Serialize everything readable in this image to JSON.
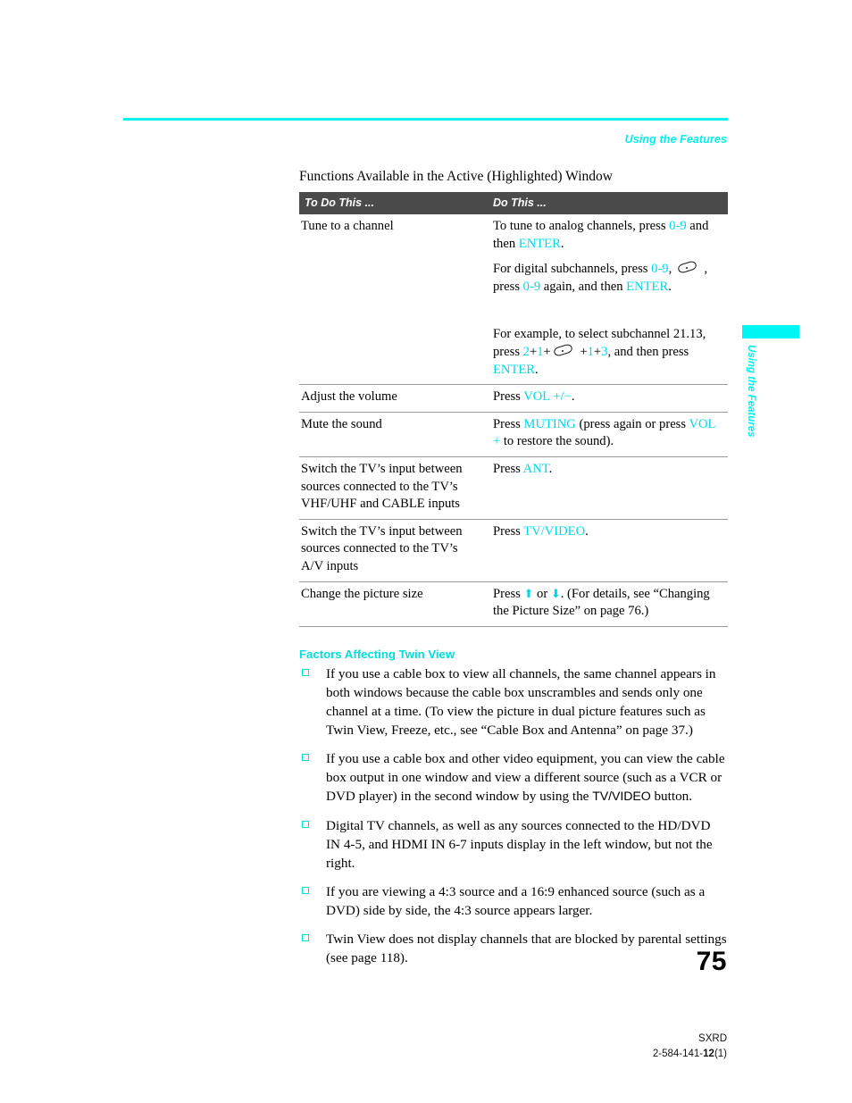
{
  "header": {
    "running_head": "Using the Features",
    "rule_color": "#00f0f0"
  },
  "side_tab": {
    "label": "Using the Features",
    "bar_color": "#00f5f5"
  },
  "table_caption": "Functions Available in the Active (Highlighted) Window",
  "table": {
    "columns": [
      "To Do This ...",
      "Do This ..."
    ],
    "header_bg": "#4b4b4b",
    "header_color": "#ffffff",
    "rows": [
      {
        "todo": "Tune to a channel",
        "do_paragraphs": [
          {
            "parts": [
              {
                "t": "To tune to analog channels, press ",
                "s": "plain"
              },
              {
                "t": "0-9",
                "s": "key"
              },
              {
                "t": " and then ",
                "s": "plain"
              },
              {
                "t": "ENTER",
                "s": "key"
              },
              {
                "t": ".",
                "s": "plain"
              }
            ]
          },
          {
            "parts": [
              {
                "t": "For digital subchannels, press ",
                "s": "plain"
              },
              {
                "t": "0-9",
                "s": "key"
              },
              {
                "t": ", ",
                "s": "plain"
              },
              {
                "t": "",
                "s": "dot-button"
              },
              {
                "t": " , press ",
                "s": "plain"
              },
              {
                "t": "0-9",
                "s": "key"
              },
              {
                "t": " again, and then ",
                "s": "plain"
              },
              {
                "t": "ENTER",
                "s": "key"
              },
              {
                "t": ".",
                "s": "plain"
              }
            ]
          },
          {
            "gap": "big",
            "parts": [
              {
                "t": "For example, to select subchannel 21.13, press ",
                "s": "plain"
              },
              {
                "t": "2",
                "s": "key"
              },
              {
                "t": "+",
                "s": "plain"
              },
              {
                "t": "1",
                "s": "key"
              },
              {
                "t": "+",
                "s": "plain"
              },
              {
                "t": "",
                "s": "dot-button"
              },
              {
                "t": " +",
                "s": "plain"
              },
              {
                "t": "1",
                "s": "key"
              },
              {
                "t": "+",
                "s": "plain"
              },
              {
                "t": "3",
                "s": "key"
              },
              {
                "t": ", and then press ",
                "s": "plain"
              },
              {
                "t": "ENTER",
                "s": "key"
              },
              {
                "t": ".",
                "s": "plain"
              }
            ]
          }
        ]
      },
      {
        "todo": "Adjust the volume",
        "do_paragraphs": [
          {
            "parts": [
              {
                "t": "Press ",
                "s": "plain"
              },
              {
                "t": "VOL +/−",
                "s": "key"
              },
              {
                "t": ".",
                "s": "plain"
              }
            ]
          }
        ]
      },
      {
        "todo": "Mute the sound",
        "do_paragraphs": [
          {
            "parts": [
              {
                "t": "Press ",
                "s": "plain"
              },
              {
                "t": "MUTING",
                "s": "key"
              },
              {
                "t": " (press again or press ",
                "s": "plain"
              },
              {
                "t": "VOL +",
                "s": "key"
              },
              {
                "t": " to restore the sound).",
                "s": "plain"
              }
            ]
          }
        ]
      },
      {
        "todo": "Switch the TV’s input between sources connected to the TV’s VHF/UHF and CABLE inputs",
        "do_paragraphs": [
          {
            "parts": [
              {
                "t": "Press ",
                "s": "plain"
              },
              {
                "t": "ANT",
                "s": "key"
              },
              {
                "t": ".",
                "s": "plain"
              }
            ]
          }
        ]
      },
      {
        "todo": "Switch the TV’s input between sources connected to the TV’s A/V inputs",
        "do_paragraphs": [
          {
            "parts": [
              {
                "t": "Press ",
                "s": "plain"
              },
              {
                "t": "TV/VIDEO",
                "s": "key"
              },
              {
                "t": ".",
                "s": "plain"
              }
            ]
          }
        ]
      },
      {
        "todo": "Change the picture size",
        "do_paragraphs": [
          {
            "parts": [
              {
                "t": "Press ",
                "s": "plain"
              },
              {
                "t": "⬆",
                "s": "arrow-up"
              },
              {
                "t": " or ",
                "s": "plain"
              },
              {
                "t": "⬇",
                "s": "arrow-down"
              },
              {
                "t": ". (For details, see “Changing the Picture Size” on page 76.)",
                "s": "plain"
              }
            ]
          }
        ]
      }
    ]
  },
  "section": {
    "heading": "Factors Affecting Twin View",
    "bullets": [
      {
        "parts": [
          {
            "t": "If you use a cable box to view all channels, the same channel appears in both windows because the cable box unscrambles and sends only one channel at a time. (To view the picture in dual picture features such as Twin View, Freeze, etc., see “Cable Box and Antenna” on page 37.)",
            "s": "plain"
          }
        ]
      },
      {
        "parts": [
          {
            "t": "If you use a cable box and other video equipment, you can view the cable box output in one window and view a different source (such as a VCR or DVD player) in the second window by using the ",
            "s": "plain"
          },
          {
            "t": "TV/VIDEO",
            "s": "keyblack"
          },
          {
            "t": " button.",
            "s": "plain"
          }
        ]
      },
      {
        "parts": [
          {
            "t": "Digital TV channels, as well as any sources connected to the HD/DVD IN 4-5, and HDMI IN 6-7 inputs display in the left window, but not the right.",
            "s": "plain"
          }
        ]
      },
      {
        "parts": [
          {
            "t": "If you are viewing a 4:3 source and a 16:9 enhanced source (such as a DVD) side by side, the 4:3 source appears larger.",
            "s": "plain"
          }
        ]
      },
      {
        "parts": [
          {
            "t": "Twin View does not display channels that are blocked by parental settings (see page 118).",
            "s": "plain"
          }
        ]
      }
    ]
  },
  "footer": {
    "page_number": "75",
    "model": "SXRD",
    "code_prefix": "2-584-141-",
    "code_bold": "12",
    "code_suffix": "(1)"
  },
  "colors": {
    "accent_cyan": "#00dede",
    "key_cyan": "#00d8e8",
    "header_gray": "#4b4b4b"
  }
}
